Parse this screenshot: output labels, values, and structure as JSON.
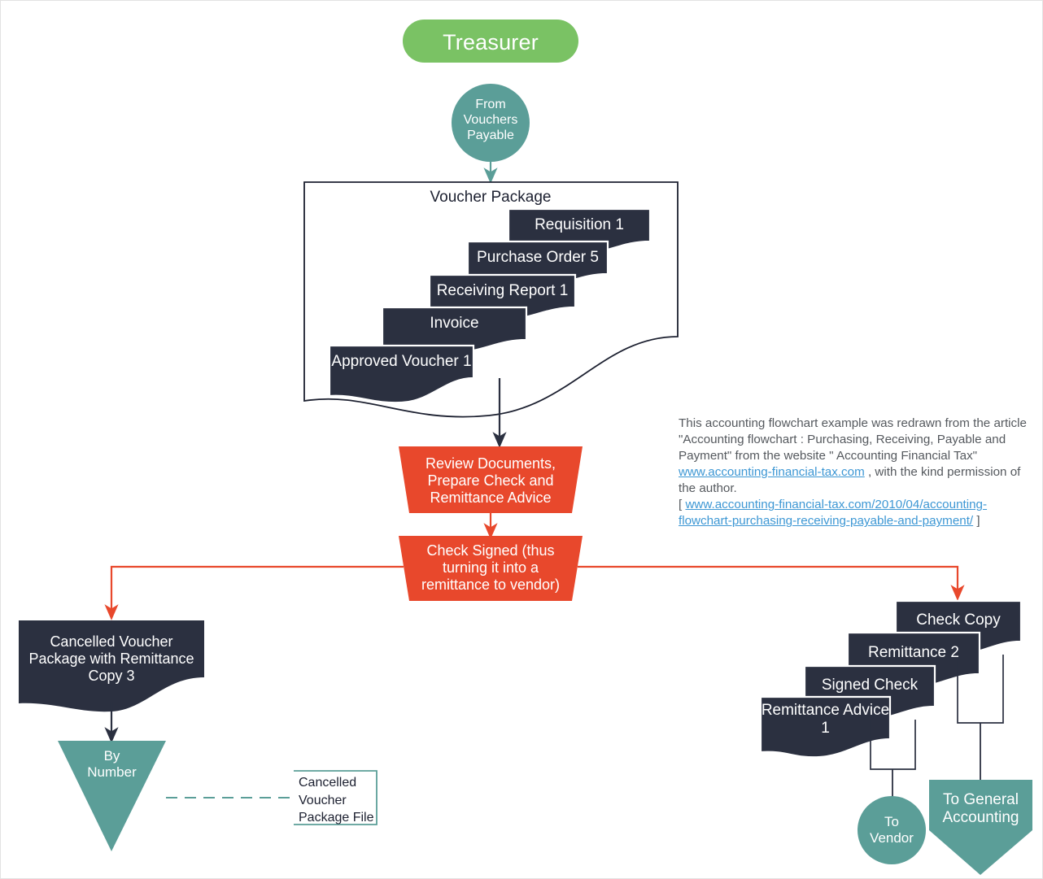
{
  "diagram": {
    "title": "Treasurer",
    "colors": {
      "title_band": "#7ac264",
      "terminator": "#5b9e98",
      "document": "#2b3040",
      "process": "#e8482c",
      "connector_dark": "#2b3040",
      "connector_orange": "#e8482c",
      "page_border": "#e2e2e2"
    }
  },
  "nodes": {
    "entry_connector": {
      "label": "From\nVouchers\nPayable",
      "shape": "circle-connector"
    },
    "voucher_package": {
      "title": "Voucher Package",
      "shape": "document-container",
      "documents": [
        {
          "label": "Requisition 1"
        },
        {
          "label": "Purchase Order 5"
        },
        {
          "label": "Receiving Report 1"
        },
        {
          "label": "Invoice"
        },
        {
          "label": "Approved Voucher 1"
        }
      ]
    },
    "review_process": {
      "label": "Review Documents,\nPrepare Check and\nRemittance Advice",
      "shape": "manual-operation"
    },
    "check_signed_process": {
      "label": "Check Signed (thus\nturning it into a\nremittance to vendor)",
      "shape": "manual-operation"
    },
    "cancelled_voucher_doc": {
      "label": "Cancelled Voucher\nPackage with Remittance\nCopy 3",
      "shape": "document"
    },
    "by_number_file": {
      "label": "By\nNumber",
      "shape": "offline-storage-triangle"
    },
    "file_annotation": {
      "label": "Cancelled\nVoucher\nPackage File",
      "shape": "annotation-bracket"
    },
    "right_documents": [
      {
        "label": "Check Copy"
      },
      {
        "label": "Remittance 2"
      },
      {
        "label": "Signed Check"
      },
      {
        "label": "Remittance Advice\n1"
      }
    ],
    "to_vendor": {
      "label": "To\nVendor",
      "shape": "circle-connector"
    },
    "to_general_accounting": {
      "label": "To General\nAccounting",
      "shape": "pentagon-connector"
    }
  },
  "attribution": {
    "line1": "This accounting flowchart example was redrawn from the article \"Accounting flowchart : Purchasing, Receiving, Payable and Payment\" from the website \" Accounting Financial Tax\" ",
    "link1_text": "www.accounting-financial-tax.com",
    "line2": " , with the kind permission of the author.",
    "bracket_open": "[ ",
    "link2_text": "www.accounting-financial-tax.com/2010/04/accounting-flowchart-purchasing-receiving-payable-and-payment/",
    "bracket_close": " ]"
  }
}
